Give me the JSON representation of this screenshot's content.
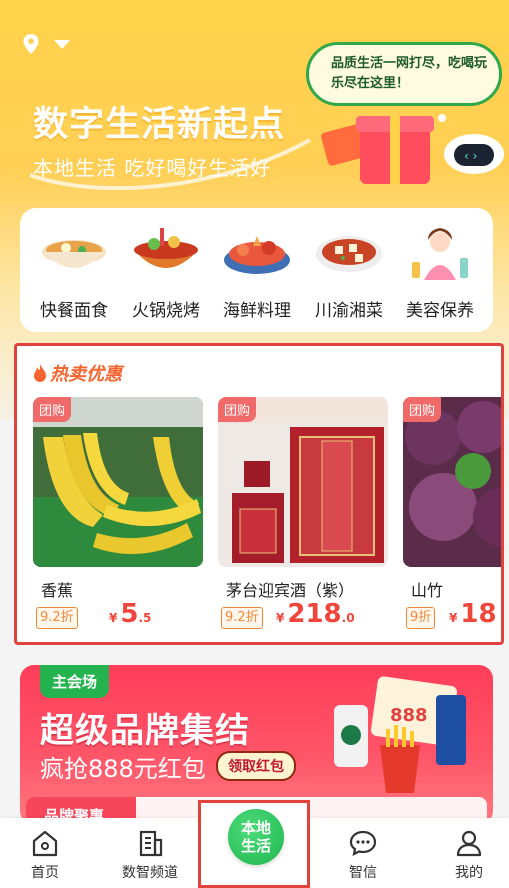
{
  "header": {
    "bubble_text": "品质生活一网打尽，吃喝玩乐尽在这里！",
    "title": "数字生活新起点",
    "subtitle": "本地生活 吃好喝好生活好"
  },
  "categories": [
    {
      "label": "快餐面食",
      "icon": "noodle-bowl-icon"
    },
    {
      "label": "火锅烧烤",
      "icon": "hotpot-icon"
    },
    {
      "label": "海鲜料理",
      "icon": "seafood-icon"
    },
    {
      "label": "川渝湘菜",
      "icon": "mapo-tofu-icon"
    },
    {
      "label": "美容保养",
      "icon": "beauty-icon"
    }
  ],
  "hot_sale": {
    "title": "热卖优惠",
    "products": [
      {
        "tag": "团购",
        "name": "香蕉",
        "discount": "9.2折",
        "currency": "¥",
        "price_int": "5",
        "price_dec": ".5"
      },
      {
        "tag": "团购",
        "name": "茅台迎宾酒（紫）",
        "discount": "9.2折",
        "currency": "¥",
        "price_int": "218",
        "price_dec": ".0"
      },
      {
        "tag": "团购",
        "name": "山竹",
        "discount": "9折",
        "currency": "¥",
        "price_int": "18",
        "price_dec": ""
      }
    ]
  },
  "banner": {
    "tag": "主会场",
    "title": "超级品牌集结",
    "subtitle": "疯抢888元红包",
    "button": "领取红包",
    "strip_label": "品牌聚惠"
  },
  "nav": {
    "home": "首页",
    "digital": "数智频道",
    "center": "本地生活",
    "message": "智信",
    "mine": "我的"
  },
  "colors": {
    "accent": "#f0453a",
    "green": "#1fb54e",
    "highlight_border": "#e0433d"
  }
}
